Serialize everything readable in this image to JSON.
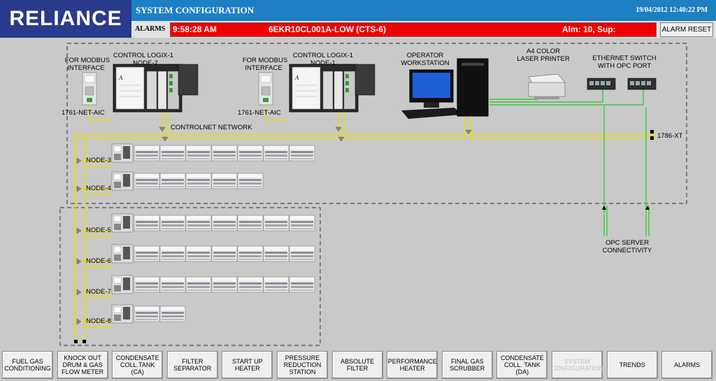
{
  "logo": {
    "text": "RELIANCE"
  },
  "header": {
    "title": "SYSTEM CONFIGURATION",
    "datetime": "19/04/2012 12:40:22 PM"
  },
  "alarms": {
    "label": "ALARMS",
    "time": "9:58:28 AM",
    "tag": "6EKR10CL001A-LOW (CTS-6)",
    "counts": "Alm:   10, Sup:",
    "reset_label": "ALARM RESET",
    "bar_color": "#ef0000"
  },
  "diagram": {
    "modbus_label_1": [
      "FOR MODBUS",
      "INTERFACE"
    ],
    "modbus_label_2": [
      "FOR MODBUS",
      "INTERFACE"
    ],
    "logix_2": [
      "CONTROL LOGIX-1",
      "NODE-2"
    ],
    "logix_1": [
      "CONTROL LOGIX-1",
      "NODE-1"
    ],
    "net_aic_1": "1761-NET-AIC",
    "net_aic_2": "1761-NET-AIC",
    "workstation": [
      "OPERATOR",
      "WORKSTATION"
    ],
    "printer": [
      "A4 COLOR",
      "LASER PRINTER"
    ],
    "switch": [
      "ETHERNET SWITCH",
      "WITH OPC PORT"
    ],
    "controlnet": "CONTROLNET NETWORK",
    "xt": "1786-XT",
    "opc": [
      "OPC SERVER",
      "CONNECTIVITY"
    ],
    "nodes": [
      "NODE-3",
      "NODE-4",
      "NODE-5",
      "NODE-6",
      "NODE-7",
      "NODE-8"
    ]
  },
  "nav": [
    {
      "label": "FUEL GAS\nCONDITIONING",
      "enabled": true
    },
    {
      "label": "KNOCK OUT\nDRUM & GAS\nFLOW METER",
      "enabled": true
    },
    {
      "label": "CONDENSATE\nCOLL.TANK\n(CA)",
      "enabled": true
    },
    {
      "label": "FILTER\nSEPARATOR",
      "enabled": true
    },
    {
      "label": "START UP\nHEATER",
      "enabled": true
    },
    {
      "label": "PRESSURE\nREDUCTION\nSTATION",
      "enabled": true
    },
    {
      "label": "ABSOLUTE\nFILTER",
      "enabled": true
    },
    {
      "label": "PERFORMANCE\nHEATER",
      "enabled": true
    },
    {
      "label": "FINAL GAS\nSCRUBBER",
      "enabled": true
    },
    {
      "label": "CONDENSATE\nCOLL. TANK\n(DA)",
      "enabled": true
    },
    {
      "label": "SYSTEM\nCONFIGURATION",
      "enabled": false
    },
    {
      "label": "TRENDS",
      "enabled": true
    },
    {
      "label": "ALARMS",
      "enabled": true
    }
  ],
  "colors": {
    "network_yellow": "#e8e000",
    "ethernet_green": "#3ccc3c",
    "title_blue": "#1e7fc4",
    "logo_blue": "#2a3a8c"
  }
}
